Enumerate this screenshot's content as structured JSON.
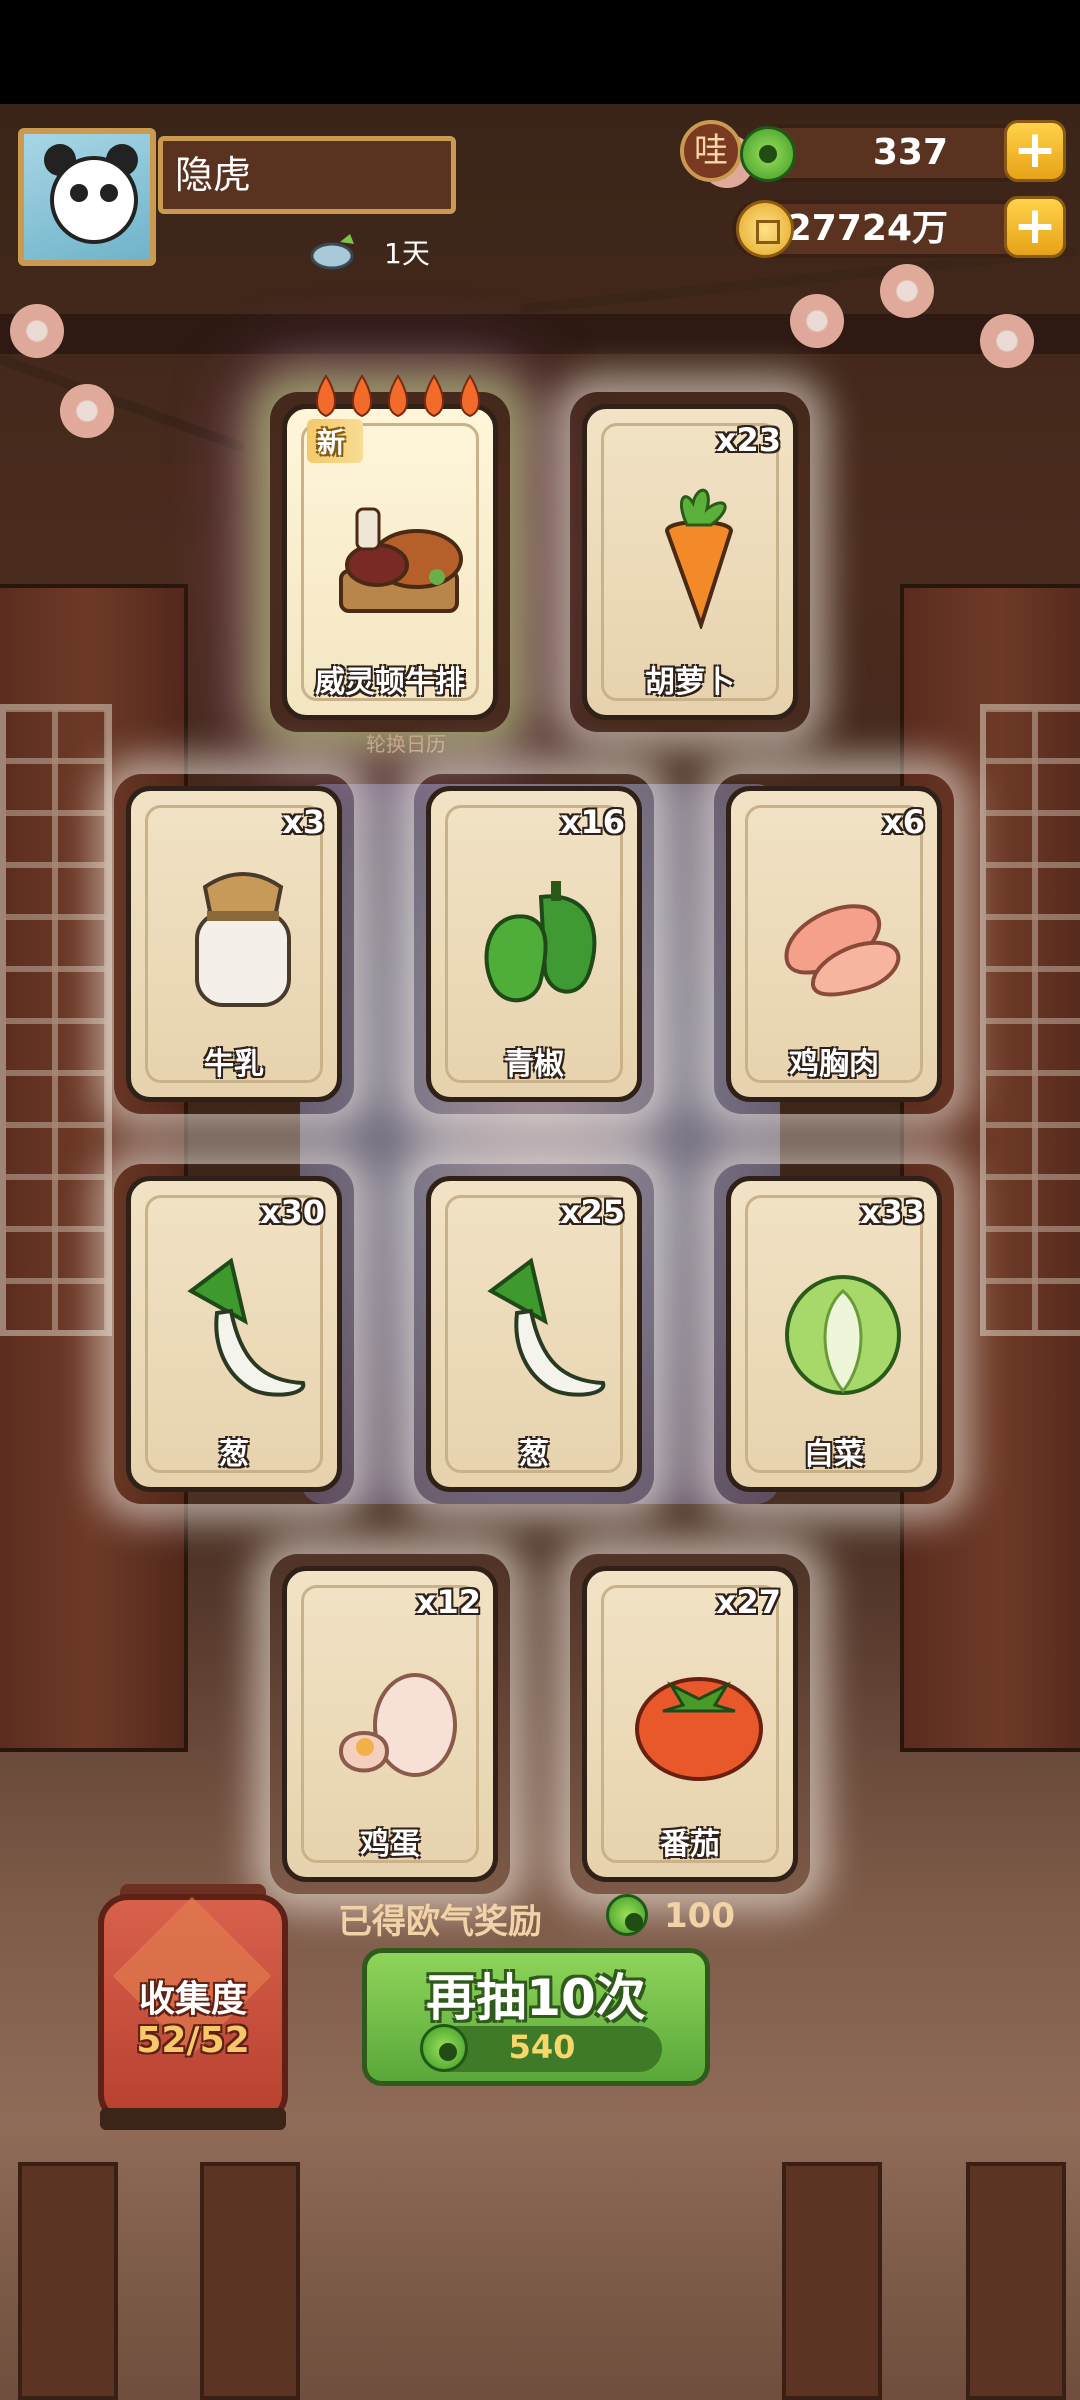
{
  "player": {
    "name": "隐虎",
    "days": "1天"
  },
  "resources": {
    "badge": "哇",
    "jade": "337",
    "gold": "27724万"
  },
  "calendar_caption": "轮换日历",
  "cards": [
    {
      "name": "威灵顿牛排",
      "count": "",
      "tag": "新",
      "special": true,
      "art": "steak-icon"
    },
    {
      "name": "胡萝卜",
      "count": "x23",
      "art": "carrot-icon"
    },
    {
      "name": "牛乳",
      "count": "x3",
      "art": "milk-jar-icon"
    },
    {
      "name": "青椒",
      "count": "x16",
      "art": "green-pepper-icon"
    },
    {
      "name": "鸡胸肉",
      "count": "x6",
      "art": "chicken-breast-icon"
    },
    {
      "name": "葱",
      "count": "x30",
      "art": "scallion-icon"
    },
    {
      "name": "葱",
      "count": "x25",
      "art": "scallion-icon"
    },
    {
      "name": "白菜",
      "count": "x33",
      "art": "napa-cabbage-icon"
    },
    {
      "name": "鸡蛋",
      "count": "x12",
      "art": "egg-icon"
    },
    {
      "name": "番茄",
      "count": "x27",
      "art": "tomato-icon"
    }
  ],
  "collection": {
    "label": "收集度",
    "value": "52/52"
  },
  "reward": {
    "label": "已得欧气奖励",
    "value": "100"
  },
  "draw": {
    "label": "再抽10次",
    "cost": "540"
  },
  "colors": {
    "accent_green": "#5aa83a",
    "gold": "#e3a825",
    "card_bg": "#f2e3c6"
  }
}
